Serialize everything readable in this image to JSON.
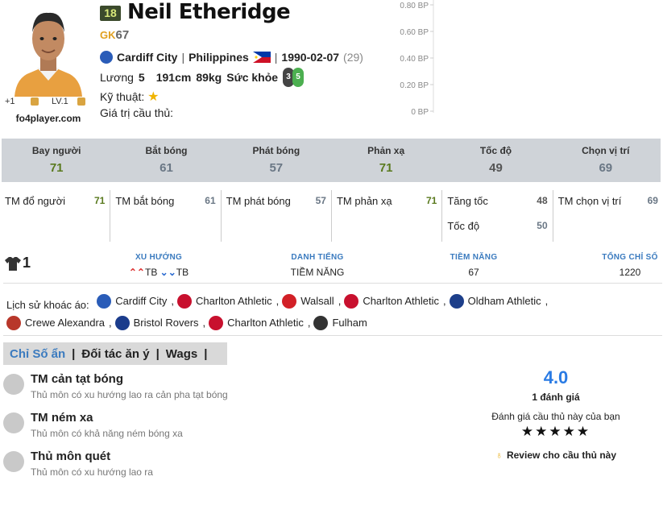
{
  "player": {
    "season": "18",
    "name": "Neil Etheridge",
    "position": "GK",
    "ovr": "67",
    "club": "Cardiff City",
    "nation": "Philippines",
    "birth": "1990-02-07",
    "age": "(29)",
    "wage_label": "Lương",
    "wage": "5",
    "height": "191cm",
    "weight": "89kg",
    "stamina_label": "Sức khỏe",
    "foot_left": "3",
    "foot_right": "5",
    "skill_label": "Kỹ thuật:",
    "value_label": "Giá trị cầu thủ:",
    "plus": "+1",
    "level": "LV.1",
    "site": "fo4player.com"
  },
  "bp_chart": {
    "ticks": [
      "0.80 BP",
      "0.60 BP",
      "0.40 BP",
      "0.20 BP",
      "0 BP"
    ]
  },
  "main_stats": [
    {
      "label": "Bay người",
      "value": "71",
      "color": "#5a7a1f"
    },
    {
      "label": "Bắt bóng",
      "value": "61",
      "color": "#6a7785"
    },
    {
      "label": "Phát bóng",
      "value": "57",
      "color": "#6a7785"
    },
    {
      "label": "Phản xạ",
      "value": "71",
      "color": "#5a7a1f"
    },
    {
      "label": "Tốc độ",
      "value": "49",
      "color": "#555555"
    },
    {
      "label": "Chọn vị trí",
      "value": "69",
      "color": "#6a7785"
    }
  ],
  "sub_stats": [
    [
      {
        "label": "TM đổ người",
        "value": "71",
        "color": "#5a7a1f"
      }
    ],
    [
      {
        "label": "TM bắt bóng",
        "value": "61",
        "color": "#6a7785"
      }
    ],
    [
      {
        "label": "TM phát bóng",
        "value": "57",
        "color": "#6a7785"
      }
    ],
    [
      {
        "label": "TM phản xạ",
        "value": "71",
        "color": "#5a7a1f"
      }
    ],
    [
      {
        "label": "Tăng tốc",
        "value": "48",
        "color": "#555555"
      },
      {
        "label": "Tốc độ",
        "value": "50",
        "color": "#6a7785"
      }
    ],
    [
      {
        "label": "TM chọn vị trí",
        "value": "69",
        "color": "#6a7785"
      }
    ]
  ],
  "info": {
    "jersey": "1",
    "trend_h": "XU HƯỚNG",
    "trend_up": "TB",
    "trend_dn": "TB",
    "rep_h": "DANH TIẾNG",
    "rep": "TIỀM NĂNG",
    "pot_h": "TIỀM NĂNG",
    "pot": "67",
    "total_h": "TỔNG CHỈ SỐ",
    "total": "1220"
  },
  "history": {
    "label": "Lịch sử khoác áo:",
    "clubs": [
      {
        "name": "Cardiff City",
        "color": "#2a5cb8"
      },
      {
        "name": "Charlton Athletic",
        "color": "#c8102e"
      },
      {
        "name": "Walsall",
        "color": "#d22027"
      },
      {
        "name": "Charlton Athletic",
        "color": "#c8102e"
      },
      {
        "name": "Oldham Athletic",
        "color": "#1d3f8a"
      },
      {
        "name": "Crewe Alexandra",
        "color": "#b8372a"
      },
      {
        "name": "Bristol Rovers",
        "color": "#1b3c8c"
      },
      {
        "name": "Charlton Athletic",
        "color": "#c8102e"
      },
      {
        "name": "Fulham",
        "color": "#333333"
      }
    ]
  },
  "tabs": [
    "Chỉ Số ẩn",
    "Đối tác ăn ý",
    "Wags"
  ],
  "traits": [
    {
      "title": "TM cản tạt bóng",
      "desc": "Thủ môn có xu hướng lao ra cản pha tạt bóng"
    },
    {
      "title": "TM ném xa",
      "desc": "Thủ môn có khả năng ném bóng xa"
    },
    {
      "title": "Thủ môn quét",
      "desc": "Thủ môn có xu hướng lao ra"
    }
  ],
  "rating": {
    "score": "4.0",
    "count": "1 đánh giá",
    "question": "Đánh giá cầu thủ này của bạn",
    "stars": "★★★★★",
    "review": "Review cho cầu thủ này"
  }
}
